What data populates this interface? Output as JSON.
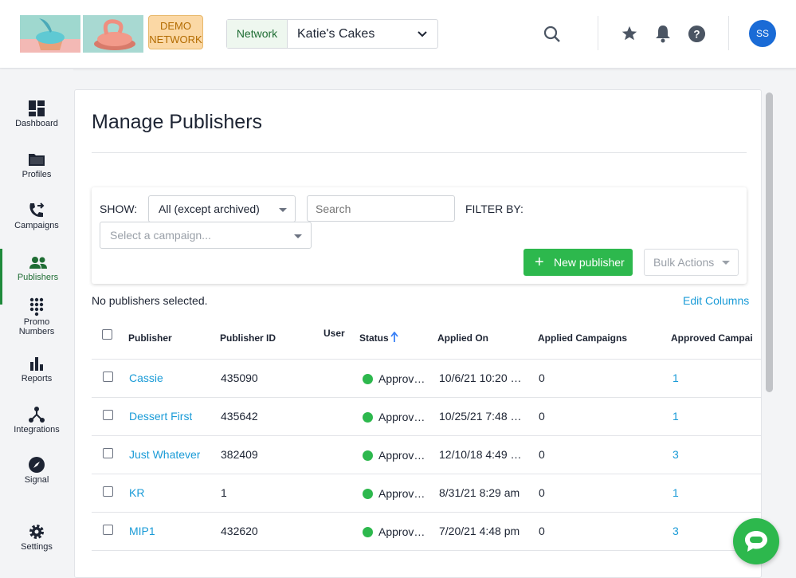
{
  "header": {
    "logo_label": "DEMO NETWORK",
    "logo_line1": "DEMO",
    "logo_line2": "NETWORK",
    "network_label": "Network",
    "network_value": "Katie's Cakes",
    "avatar_initials": "SS",
    "icons": [
      "search-icon",
      "star-icon",
      "bell-icon",
      "help-icon"
    ]
  },
  "sidebar": {
    "items": [
      {
        "label": "Dashboard",
        "icon": "dashboard-icon"
      },
      {
        "label": "Profiles",
        "icon": "folder-icon"
      },
      {
        "label": "Campaigns",
        "icon": "phone-forward-icon"
      },
      {
        "label": "Publishers",
        "icon": "people-icon",
        "active": true
      },
      {
        "label": "Promo Numbers",
        "line1": "Promo",
        "line2": "Numbers",
        "icon": "dialpad-icon"
      },
      {
        "label": "Reports",
        "icon": "bar-chart-icon"
      },
      {
        "label": "Integrations",
        "icon": "integrations-icon"
      },
      {
        "label": "Signal",
        "icon": "compass-icon"
      },
      {
        "label": "Settings",
        "icon": "gear-icon"
      }
    ]
  },
  "main": {
    "title": "Manage Publishers",
    "filters": {
      "show_label": "SHOW:",
      "show_value": "All (except archived)",
      "search_placeholder": "Search",
      "filter_by_label": "FILTER BY:",
      "campaign_placeholder": "Select a campaign...",
      "new_publisher_label": "New publisher",
      "bulk_actions_label": "Bulk Actions"
    },
    "selection_status": "No publishers selected.",
    "edit_columns_label": "Edit Columns",
    "table": {
      "columns": [
        "Publisher",
        "Publisher ID",
        "User",
        "Status",
        "Applied On",
        "Applied Campaigns",
        "Approved Campai"
      ],
      "rows": [
        {
          "publisher": "Cassie",
          "id": "435090",
          "user": "",
          "status": "Approv…",
          "applied_on": "10/6/21 10:20 …",
          "applied": "0",
          "approved": "1"
        },
        {
          "publisher": "Dessert First",
          "id": "435642",
          "user": "",
          "status": "Approv…",
          "applied_on": "10/25/21 7:48 …",
          "applied": "0",
          "approved": "1"
        },
        {
          "publisher": "Just Whatever",
          "id": "382409",
          "user": "",
          "status": "Approv…",
          "applied_on": "12/10/18 4:49 …",
          "applied": "0",
          "approved": "3"
        },
        {
          "publisher": "KR",
          "id": "1",
          "user": "",
          "status": "Approv…",
          "applied_on": "8/31/21 8:29 am",
          "applied": "0",
          "approved": "1"
        },
        {
          "publisher": "MIP1",
          "id": "432620",
          "user": "",
          "status": "Approv…",
          "applied_on": "7/20/21 4:48 pm",
          "applied": "0",
          "approved": "3"
        }
      ]
    }
  },
  "colors": {
    "accent": "#2db84d",
    "link": "#1a9bd7",
    "avatar": "#1a6bd6"
  }
}
